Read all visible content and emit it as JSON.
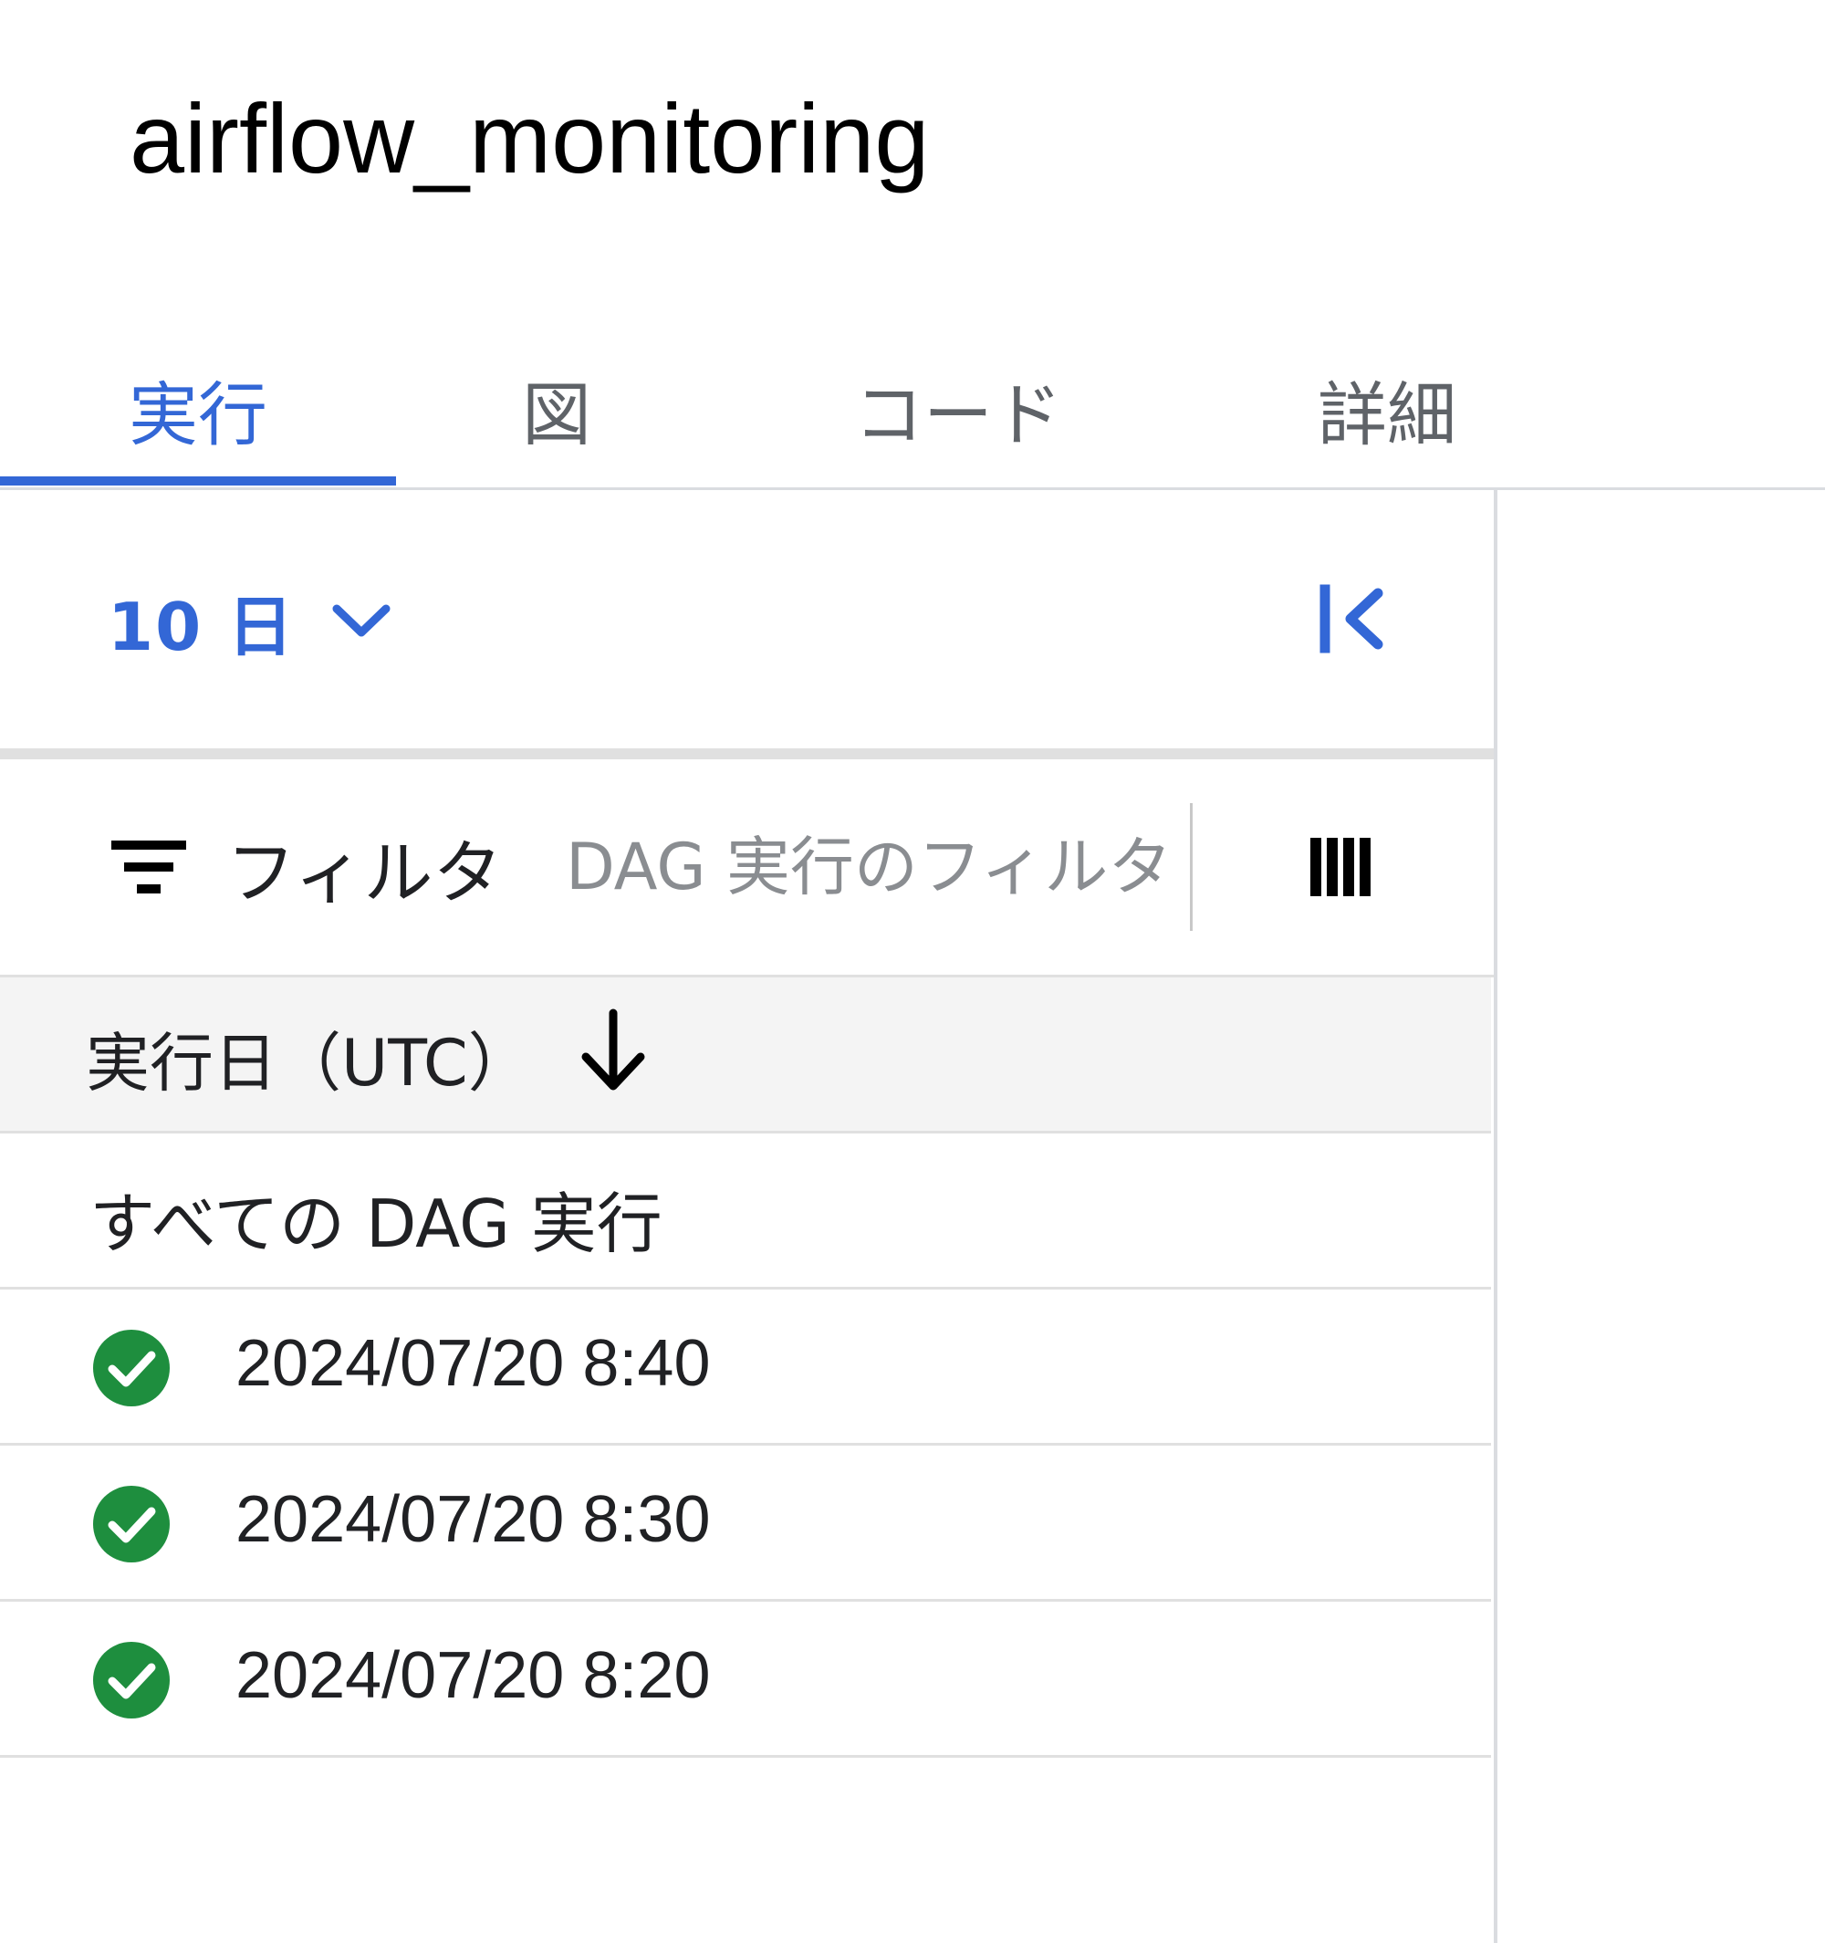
{
  "page": {
    "title": "airflow_monitoring"
  },
  "tabs": [
    {
      "label": "実行",
      "active": true
    },
    {
      "label": "図",
      "active": false
    },
    {
      "label": "コード",
      "active": false
    },
    {
      "label": "詳細",
      "active": false
    }
  ],
  "colors": {
    "accent": "#3367d6",
    "success": "#1e8e3e",
    "divider": "#dadce0",
    "header_bg": "#f4f4f4"
  },
  "range": {
    "label": "10 日",
    "icon": "chevron-down-icon"
  },
  "collapse": {
    "icon": "collapse-left-icon"
  },
  "filter": {
    "label": "フィルタ",
    "icon": "filter-list-icon",
    "placeholder": "DAG 実行のフィルタ",
    "value": ""
  },
  "columns_button": {
    "icon": "column-selector-icon"
  },
  "table": {
    "header": {
      "label": "実行日（UTC）",
      "sort_icon": "arrow-downward-icon"
    },
    "all_runs_label": "すべての DAG 実行",
    "rows": [
      {
        "status": "success",
        "status_icon": "check-circle-icon",
        "date": "2024/07/20 8:40"
      },
      {
        "status": "success",
        "status_icon": "check-circle-icon",
        "date": "2024/07/20 8:30"
      },
      {
        "status": "success",
        "status_icon": "check-circle-icon",
        "date": "2024/07/20 8:20"
      }
    ]
  }
}
